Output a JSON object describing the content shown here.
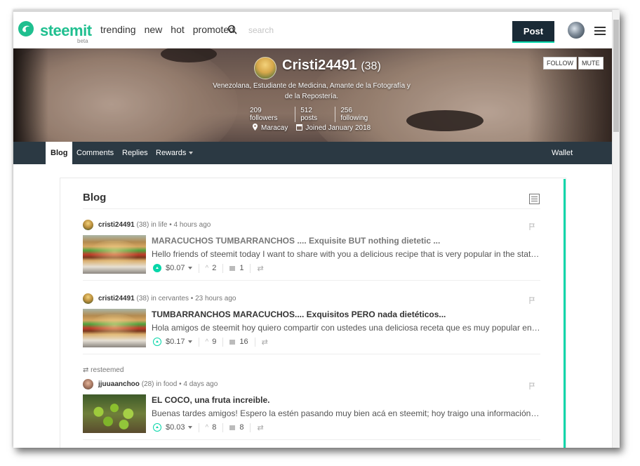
{
  "app": {
    "brand": "steemit",
    "beta": "beta"
  },
  "header": {
    "nav": [
      "trending",
      "new",
      "hot",
      "promoted"
    ],
    "search_placeholder": "search",
    "post_label": "Post"
  },
  "profile": {
    "name": "Cristi24491",
    "reputation": "(38)",
    "bio": "Venezolana, Estudiante de Medicina, Amante de la Fotografía y de la Repostería.",
    "followers": "209 followers",
    "posts": "512 posts",
    "following": "256 following",
    "location": "Maracay",
    "joined": "Joined January 2018",
    "follow_label": "FOLLOW",
    "mute_label": "MUTE"
  },
  "tabs": {
    "blog": "Blog",
    "comments": "Comments",
    "replies": "Replies",
    "rewards": "Rewards",
    "wallet": "Wallet"
  },
  "blog": {
    "title": "Blog",
    "posts": [
      {
        "author": "cristi24491",
        "rep": "(38)",
        "category": "life",
        "time": "4 hours ago",
        "title": "MARACUCHOS TUMBARRANCHOS .... Exquisite BUT nothing dietetic ...",
        "body": "Hello friends of steemit today I want to share with you a delicious recipe that is very popular in the state of Zulia...",
        "payout": "$0.07",
        "votes": "2",
        "comments": "1"
      },
      {
        "author": "cristi24491",
        "rep": "(38)",
        "category": "cervantes",
        "time": "23 hours ago",
        "title": "TUMBARRANCHOS MARACUCHOS.... Exquisitos PERO nada dietéticos...",
        "body": "Hola amigos de steemit hoy quiero compartir con ustedes una deliciosa receta que es muy popular en el estado...",
        "payout": "$0.17",
        "votes": "9",
        "comments": "16"
      },
      {
        "resteemed": "resteemed",
        "author": "jjuuaanchoo",
        "rep": "(28)",
        "category": "food",
        "time": "4 days ago",
        "title": "EL COCO, una fruta increible.",
        "body": "Buenas tardes amigos! Espero la estén pasando muy bien acá en steemit; hoy traigo una información que me p...",
        "payout": "$0.03",
        "votes": "8",
        "comments": "8"
      }
    ]
  },
  "colors": {
    "accent": "#06d6a9",
    "brand": "#1fbf8f",
    "dark": "#1a2a36",
    "tabbar": "#2b3943"
  }
}
